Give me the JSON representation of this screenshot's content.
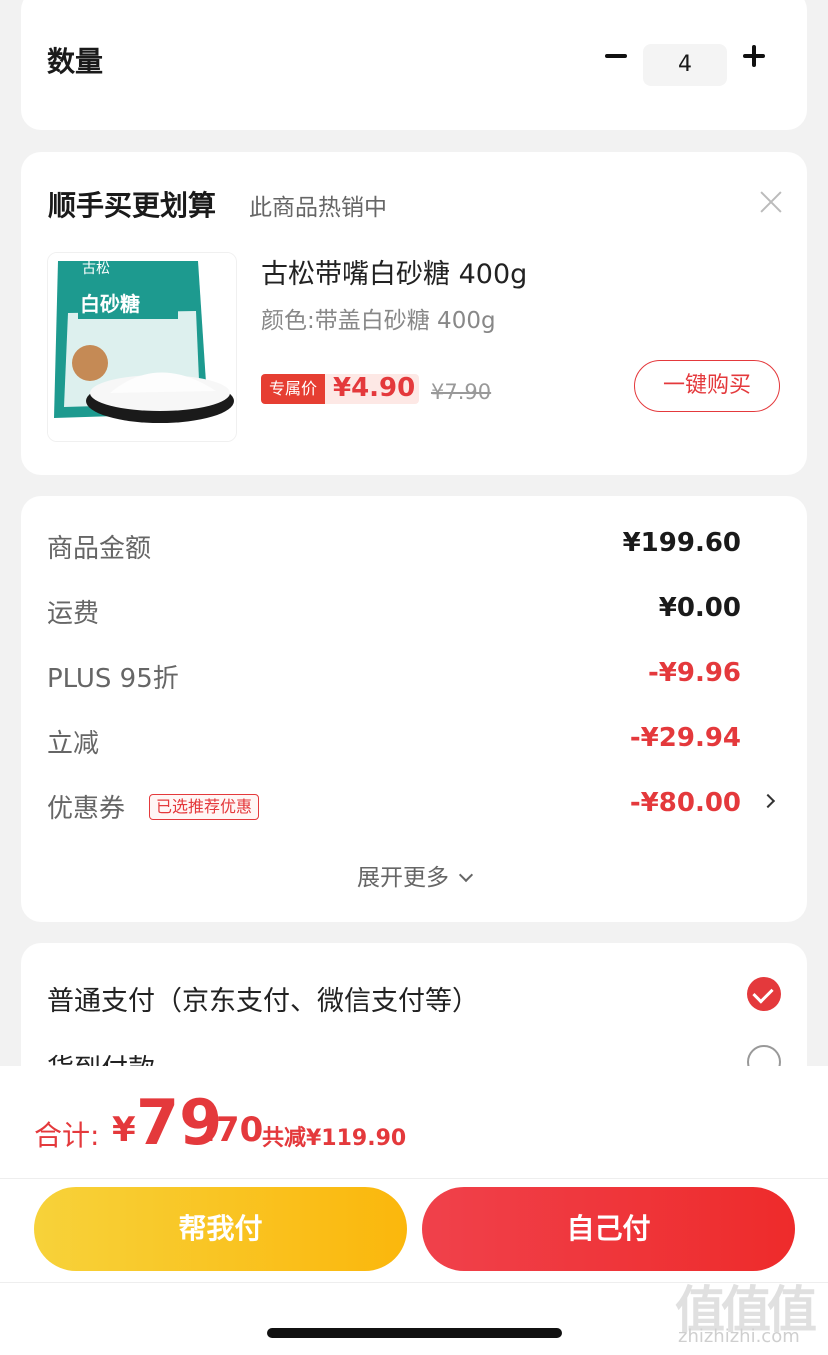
{
  "quantity": {
    "label": "数量",
    "value": "4"
  },
  "recommend": {
    "title": "顺手买更划算",
    "subtitle": "此商品热销中",
    "product": {
      "name": "古松带嘴白砂糖 400g",
      "spec": "颜色:带盖白砂糖 400g",
      "tag": "专属价",
      "price": "¥4.90",
      "old_price": "¥7.90",
      "buy_label": "一键购买",
      "image_logo": "古松",
      "image_text": "白砂糖"
    }
  },
  "amounts": {
    "rows": [
      {
        "label": "商品金额",
        "value": "¥199.60"
      },
      {
        "label": "运费",
        "value": "¥0.00"
      },
      {
        "label": "PLUS 95折",
        "value": "-¥9.96"
      },
      {
        "label": "立减",
        "value": "-¥29.94"
      },
      {
        "label": "优惠券",
        "value": "-¥80.00"
      }
    ],
    "coupon_badge": "已选推荐优惠",
    "expand_label": "展开更多"
  },
  "payment": {
    "option1": "普通支付（京东支付、微信支付等）",
    "option2": "货到付款"
  },
  "summary": {
    "label": "合计:",
    "currency": "¥",
    "integer": "79",
    "decimal": ".70",
    "saved": "共减¥119.90"
  },
  "actions": {
    "help_pay": "帮我付",
    "self_pay": "自己付"
  },
  "watermark": {
    "logo": "值值值",
    "url": "zhizhizhi.com"
  },
  "colors": {
    "accent": "#e4393c",
    "help_pay": "#fbc21b",
    "self_pay": "#ef3a3f"
  }
}
